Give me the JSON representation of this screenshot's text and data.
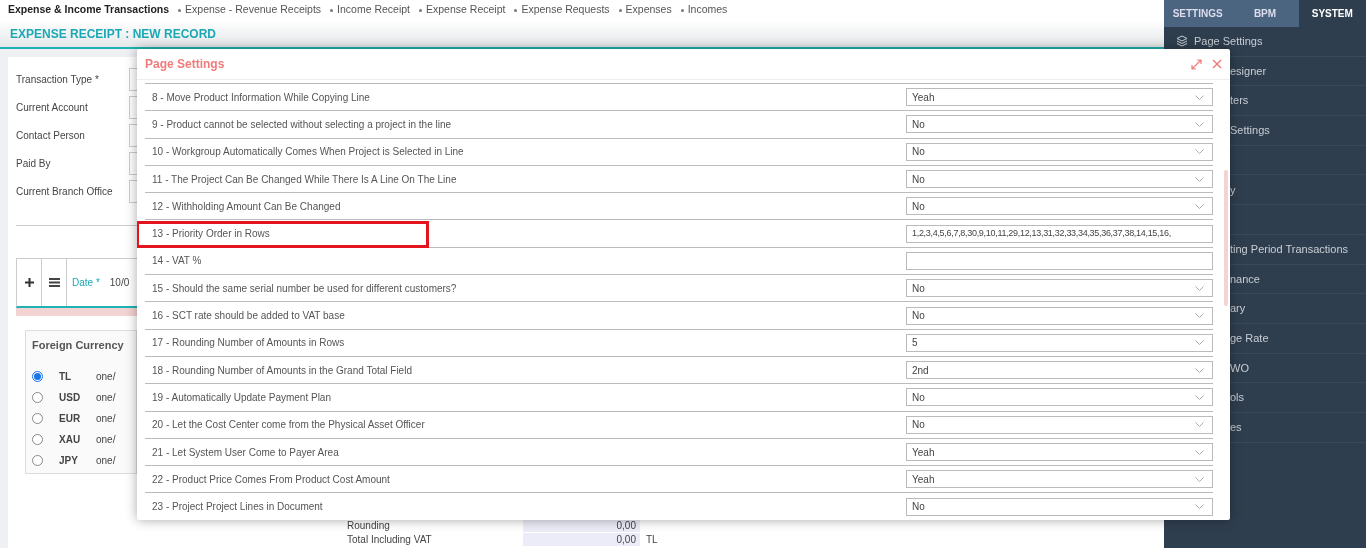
{
  "breadcrumb": [
    {
      "label": "Expense & Income Transactions",
      "current": true
    },
    {
      "label": "Expense - Revenue Receipts",
      "current": false
    },
    {
      "label": "Income Receipt",
      "current": false
    },
    {
      "label": "Expense Receipt",
      "current": false
    },
    {
      "label": "Expense Requests",
      "current": false
    },
    {
      "label": "Expenses",
      "current": false
    },
    {
      "label": "Incomes",
      "current": false
    }
  ],
  "page_title": "EXPENSE RECEIPT : NEW RECORD",
  "form_fields": [
    {
      "label": "Transaction Type *"
    },
    {
      "label": "Current Account"
    },
    {
      "label": "Contact Person"
    },
    {
      "label": "Paid By"
    },
    {
      "label": "Current Branch Office"
    }
  ],
  "line_table": {
    "date_label": "Date *",
    "date_value": "10/0"
  },
  "foreign_currency": {
    "title": "Foreign Currency",
    "rows": [
      {
        "code": "TL",
        "rate": "one/",
        "selected": true
      },
      {
        "code": "USD",
        "rate": "one/",
        "selected": false
      },
      {
        "code": "EUR",
        "rate": "one/",
        "selected": false
      },
      {
        "code": "XAU",
        "rate": "one/",
        "selected": false
      },
      {
        "code": "JPY",
        "rate": "one/",
        "selected": false
      }
    ]
  },
  "totals": [
    {
      "label": "Rounding",
      "value": "0,00"
    },
    {
      "label": "Total Including VAT",
      "value": "0,00",
      "currency": "TL"
    }
  ],
  "side_panel": {
    "tabs": [
      {
        "label": "SETTINGS",
        "selected": false
      },
      {
        "label": "BPM",
        "selected": false
      },
      {
        "label": "SYSTEM",
        "selected": true
      }
    ],
    "items": [
      {
        "kind": "item",
        "label": "Page Settings",
        "covered": false
      },
      {
        "kind": "item",
        "label": "esigner",
        "covered": true
      },
      {
        "kind": "item",
        "label": "ters",
        "covered": true
      },
      {
        "kind": "item",
        "label": "Settings",
        "covered": true
      },
      {
        "kind": "blank"
      },
      {
        "kind": "item",
        "label": "y",
        "covered": true
      },
      {
        "kind": "blank"
      },
      {
        "kind": "item",
        "label": "ting Period Transactions",
        "covered": true
      },
      {
        "kind": "item",
        "label": "nance",
        "covered": true
      },
      {
        "kind": "item",
        "label": "ary",
        "covered": true
      },
      {
        "kind": "item",
        "label": "ge Rate",
        "covered": true
      },
      {
        "kind": "item",
        "label": "WO",
        "covered": true
      },
      {
        "kind": "item",
        "label": "ols",
        "covered": true
      },
      {
        "kind": "item",
        "label": "es",
        "covered": true
      }
    ]
  },
  "dialog": {
    "title": "Page Settings",
    "settings": [
      {
        "label": "8 - Move Product Information While Copying Line",
        "kind": "select",
        "value": "Yeah",
        "highlighted": false
      },
      {
        "label": "9 - Product cannot be selected without selecting a project in the line",
        "kind": "select",
        "value": "No",
        "highlighted": false
      },
      {
        "label": "10 - Workgroup Automatically Comes When Project is Selected in Line",
        "kind": "select",
        "value": "No",
        "highlighted": false
      },
      {
        "label": "11 - The Project Can Be Changed While There Is A Line On The Line",
        "kind": "select",
        "value": "No",
        "highlighted": false
      },
      {
        "label": "12 - Withholding Amount Can Be Changed",
        "kind": "select",
        "value": "No",
        "highlighted": false
      },
      {
        "label": "13 - Priority Order in Rows",
        "kind": "text",
        "value": "1,2,3,4,5,6,7,8,30,9,10,11,29,12,13,31,32,33,34,35,36,37,38,14,15,16,",
        "highlighted": true
      },
      {
        "label": "14 - VAT %",
        "kind": "text",
        "highlighted": false
      },
      {
        "label": "15 - Should the same serial number be used for different customers?",
        "kind": "select",
        "value": "No",
        "highlighted": false
      },
      {
        "label": "16 - SCT rate should be added to VAT base",
        "kind": "select",
        "value": "No",
        "highlighted": false
      },
      {
        "label": "17 - Rounding Number of Amounts in Rows",
        "kind": "select",
        "value": "5",
        "highlighted": false
      },
      {
        "label": "18 - Rounding Number of Amounts in the Grand Total Field",
        "kind": "select",
        "value": "2nd",
        "highlighted": false
      },
      {
        "label": "19 - Automatically Update Payment Plan",
        "kind": "select",
        "value": "No",
        "highlighted": false
      },
      {
        "label": "20 - Let the Cost Center come from the Physical Asset Officer",
        "kind": "select",
        "value": "No",
        "highlighted": false
      },
      {
        "label": "21 - Let System User Come to Payer Area",
        "kind": "select",
        "value": "Yeah",
        "highlighted": false
      },
      {
        "label": "22 - Product Price Comes From Product Cost Amount",
        "kind": "select",
        "value": "Yeah",
        "highlighted": false
      },
      {
        "label": "23 - Project Project Lines in Document",
        "kind": "select",
        "value": "No",
        "highlighted": false
      }
    ]
  }
}
